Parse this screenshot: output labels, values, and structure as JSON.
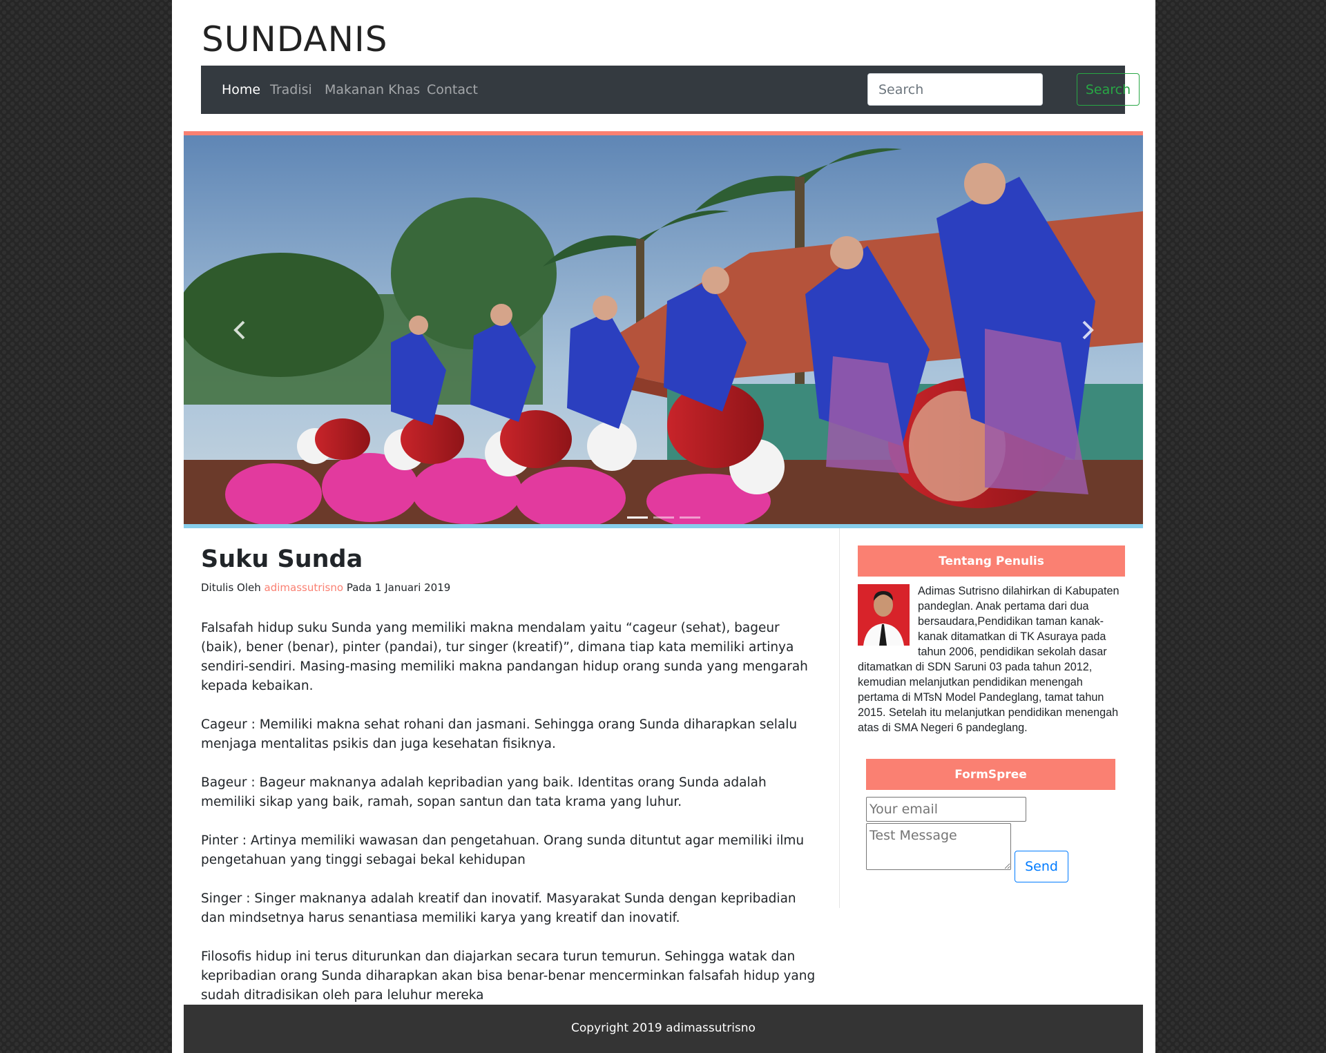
{
  "site": {
    "title": "SUNDANIS"
  },
  "nav": {
    "items": [
      {
        "label": "Home",
        "active": true
      },
      {
        "label": "Tradisi",
        "active": false
      },
      {
        "label": "Makanan Khas",
        "active": false
      },
      {
        "label": "Contact",
        "active": false
      }
    ],
    "search_placeholder": "Search",
    "search_button": "Search"
  },
  "carousel": {
    "prev_icon": "chevron-left-icon",
    "next_icon": "chevron-right-icon",
    "slide_count": 3,
    "active_slide": 1
  },
  "article": {
    "title": "Suku Sunda",
    "byline_prefix": "Ditulis Oleh",
    "author": "adimassutrisno",
    "byline_suffix": "Pada 1 Januari 2019",
    "paragraphs": [
      "Falsafah hidup suku Sunda yang memiliki makna mendalam yaitu “cageur (sehat), bageur (baik), bener (benar), pinter (pandai), tur singer (kreatif)”, dimana tiap kata memiliki artinya sendiri-sendiri. Masing-masing memiliki makna pandangan hidup orang sunda yang mengarah kepada kebaikan.",
      "Cageur : Memiliki makna sehat rohani dan jasmani. Sehingga orang Sunda diharapkan selalu menjaga mentalitas psikis dan juga kesehatan fisiknya.",
      "Bageur : Bageur maknanya adalah kepribadian yang baik. Identitas orang Sunda adalah memiliki sikap yang baik, ramah, sopan santun dan tata krama yang luhur.",
      "Pinter : Artinya memiliki wawasan dan pengetahuan. Orang sunda dituntut agar memiliki ilmu pengetahuan yang tinggi sebagai bekal kehidupan",
      "Singer : Singer maknanya adalah kreatif dan inovatif. Masyarakat Sunda dengan kepribadian dan mindsetnya harus senantiasa memiliki karya yang kreatif dan inovatif.",
      "Filosofis hidup ini terus diturunkan dan diajarkan secara turun temurun. Sehingga watak dan kepribadian orang Sunda diharapkan akan bisa benar-benar mencerminkan falsafah hidup yang sudah ditradisikan oleh para leluhur mereka"
    ]
  },
  "sidebar": {
    "about": {
      "heading": "Tentang Penulis",
      "text": "Adimas Sutrisno dilahirkan di Kabupaten pandeglan. Anak pertama dari dua bersaudara,Pendidikan taman kanak-kanak ditamatkan di TK Asuraya pada tahun 2006, pendidikan sekolah dasar ditamatkan di SDN Saruni 03 pada tahun 2012, kemudian melanjutkan pendidikan menengah pertama di MTsN Model Pandeglang, tamat tahun 2015. Setelah itu melanjutkan pendidikan menengah atas di SMA Negeri 6 pandeglang."
    },
    "form": {
      "heading": "FormSpree",
      "email_placeholder": "Your email",
      "message_placeholder": "Test Message",
      "send_label": "Send"
    }
  },
  "footer": {
    "text": "Copyright 2019 adimassutrisno"
  },
  "colors": {
    "accent": "#fa8072",
    "hero_bottom": "#87ceeb",
    "navbar": "#343a40",
    "footer": "#343434",
    "search_green": "#28a745",
    "send_blue": "#007bff"
  }
}
